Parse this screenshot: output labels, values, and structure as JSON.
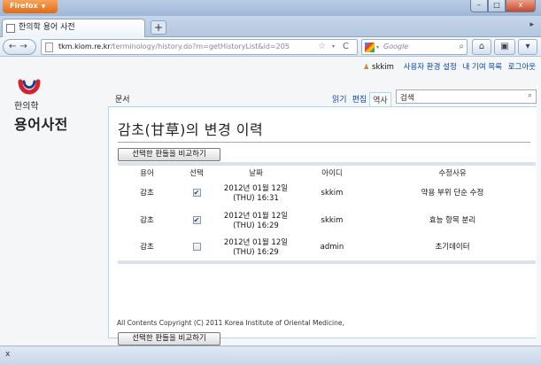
{
  "browser": {
    "app_button": "Firefox",
    "window_buttons": [
      "–",
      "□",
      "x"
    ],
    "tab_title": "한의학 용어 사전",
    "new_tab": "+",
    "tab_list_arrow": "▸",
    "nav_back_forward": "←→",
    "url_domain": "tkm.kiom.re.kr",
    "url_path": "/terminology/history.do?m=getHistoryList&id=205",
    "url_star": "☆",
    "url_dropdown": "▾",
    "url_reload": "C",
    "search_placeholder": "Google",
    "search_engine_dropdown": "▾",
    "search_go": "⌕",
    "home_icon": "⌂",
    "bookmarks_icon": "▣",
    "menu_icon": "▾",
    "status_close": "x"
  },
  "user_links": {
    "username": "skkim",
    "preferences": "사용자 환경 설정",
    "contributions": "내 기여 목록",
    "logout": "로그아웃"
  },
  "logo": {
    "subtitle": "한의학",
    "title": "용어사전"
  },
  "tabs": {
    "page": "문서",
    "read": "읽기",
    "edit": "편집",
    "history": "역사"
  },
  "wiki_search": {
    "value": "검색",
    "icon": "⌕"
  },
  "page_title": "감초(甘草)의 변경 이력",
  "compare_button": "선택한 판들을 비교하기",
  "table": {
    "headers": [
      "용어",
      "선택",
      "날짜",
      "아이디",
      "수정사유"
    ],
    "rows": [
      {
        "term": "감초",
        "checked": "✔",
        "date_line1": "2012년 01월 12일",
        "date_line2": "(THU) 16:31",
        "user": "skkim",
        "reason": "약용 부위 단순 수정"
      },
      {
        "term": "감초",
        "checked": "✔",
        "date_line1": "2012년 01월 12일",
        "date_line2": "(THU) 16:29",
        "user": "skkim",
        "reason": "효능 항목 분리"
      },
      {
        "term": "감초",
        "checked": "",
        "date_line1": "2012년 01월 12일",
        "date_line2": "(THU) 16:29",
        "user": "admin",
        "reason": "초기데이터"
      }
    ]
  },
  "footer": "All Contents Copyright (C) 2011 Korea Institute of Oriental Medicine,"
}
